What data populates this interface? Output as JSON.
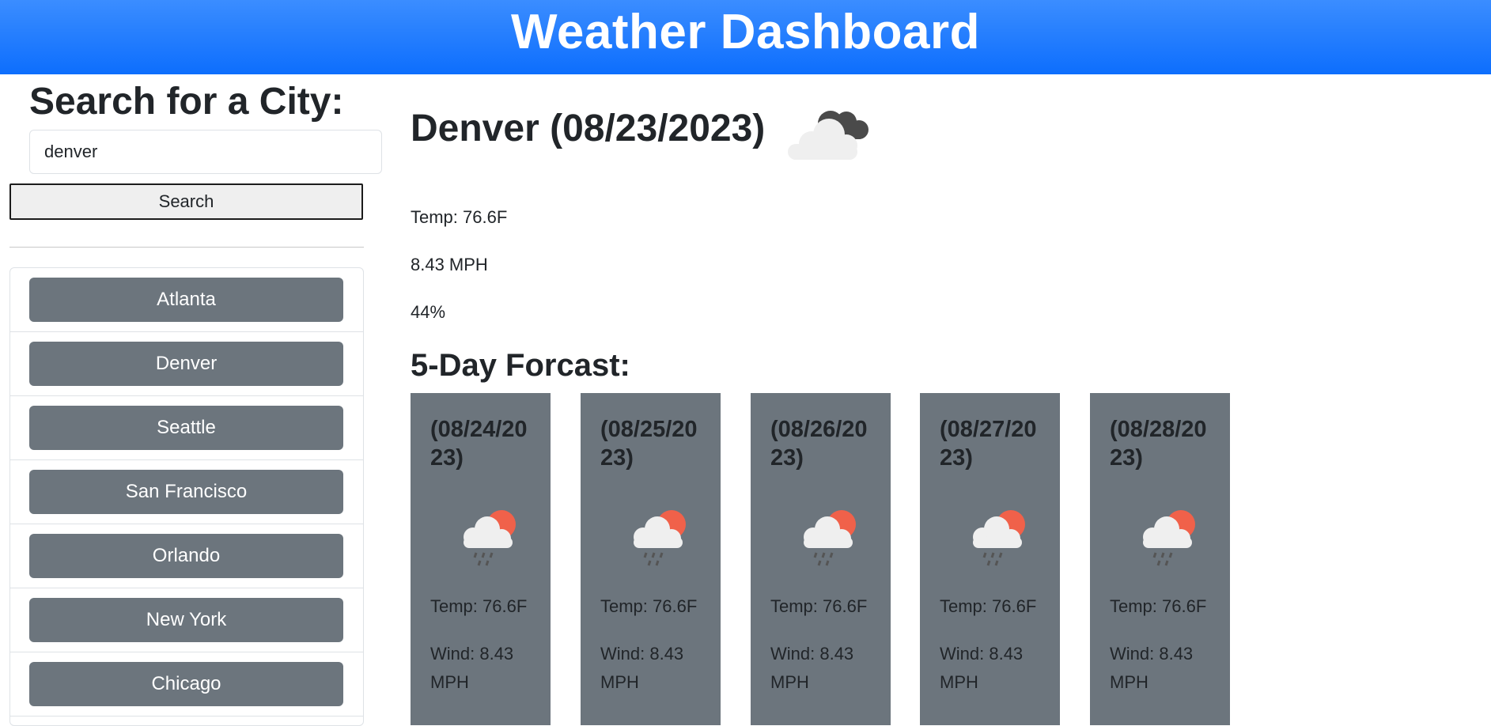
{
  "header": {
    "title": "Weather Dashboard"
  },
  "sidebar": {
    "title": "Search for a City:",
    "search_value": "denver",
    "search_button": "Search",
    "history": [
      "Atlanta",
      "Denver",
      "Seattle",
      "San Francisco",
      "Orlando",
      "New York",
      "Chicago"
    ]
  },
  "current": {
    "title": "Denver (08/23/2023)",
    "icon": "cloudy-icon",
    "temp": "Temp: 76.6F",
    "wind": "8.43 MPH",
    "humidity": "44%"
  },
  "forecast": {
    "title": "5-Day Forcast:",
    "days": [
      {
        "date": "(08/24/2023)",
        "icon": "rain-sun-icon",
        "temp": "Temp: 76.6F",
        "wind": "Wind: 8.43 MPH"
      },
      {
        "date": "(08/25/2023)",
        "icon": "rain-sun-icon",
        "temp": "Temp: 76.6F",
        "wind": "Wind: 8.43 MPH"
      },
      {
        "date": "(08/26/2023)",
        "icon": "rain-sun-icon",
        "temp": "Temp: 76.6F",
        "wind": "Wind: 8.43 MPH"
      },
      {
        "date": "(08/27/2023)",
        "icon": "rain-sun-icon",
        "temp": "Temp: 76.6F",
        "wind": "Wind: 8.43 MPH"
      },
      {
        "date": "(08/28/2023)",
        "icon": "rain-sun-icon",
        "temp": "Temp: 76.6F",
        "wind": "Wind: 8.43 MPH"
      }
    ]
  },
  "colors": {
    "header": "#0d6efd",
    "card": "#6c757d",
    "history_button": "#6c757d",
    "sun": "#f0614a"
  }
}
